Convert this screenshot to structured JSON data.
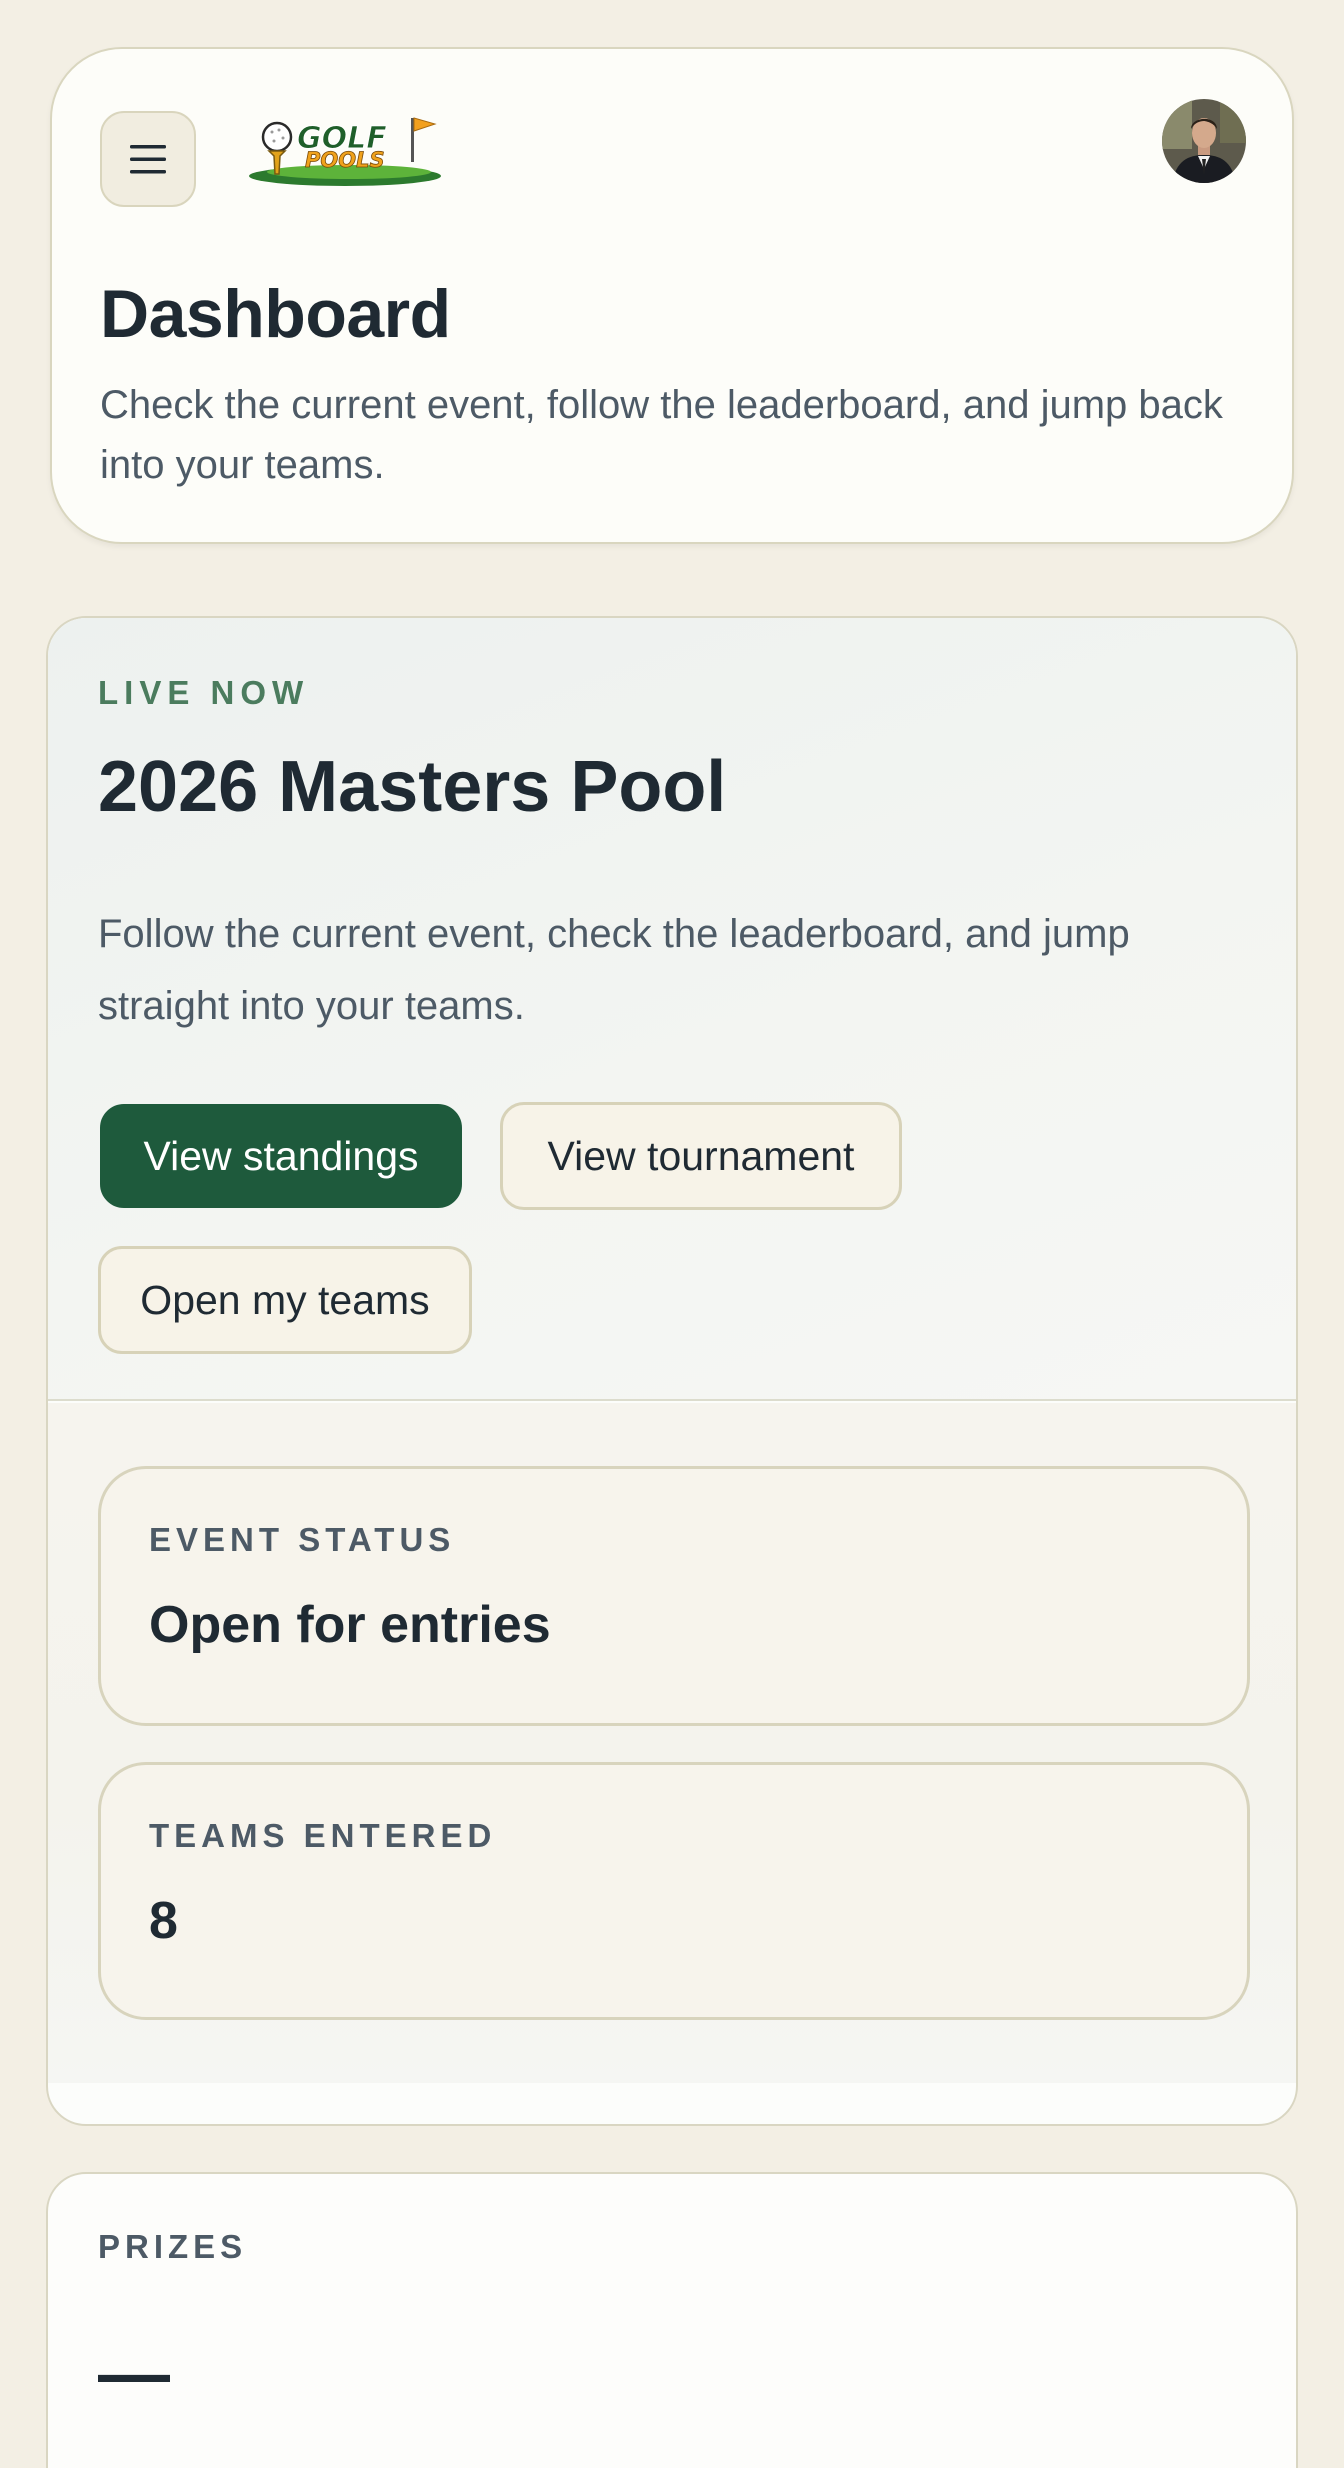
{
  "header": {
    "menu_icon": "hamburger-menu-icon",
    "logo": {
      "line1": "GOLF",
      "line2": "POOLS"
    },
    "avatar_icon": "user-avatar",
    "title": "Dashboard",
    "subtitle": "Check the current event, follow the leaderboard, and jump back into your teams."
  },
  "event": {
    "eyebrow": "LIVE NOW",
    "title": "2026 Masters Pool",
    "description": "Follow the current event, check the leaderboard, and jump straight into your teams.",
    "actions": {
      "standings": "View standings",
      "tournament": "View tournament",
      "teams": "Open my teams"
    },
    "stats": [
      {
        "label": "EVENT STATUS",
        "value": "Open for entries"
      },
      {
        "label": "TEAMS ENTERED",
        "value": "8"
      }
    ]
  },
  "prizes": {
    "label": "PRIZES",
    "value": "—"
  },
  "colors": {
    "page_bg": "#f3efe4",
    "primary": "#1e5a3c",
    "accent_green": "#4b7c5e",
    "text": "#1f2a33",
    "muted": "#4d5a66",
    "border": "#d9d6c2"
  }
}
